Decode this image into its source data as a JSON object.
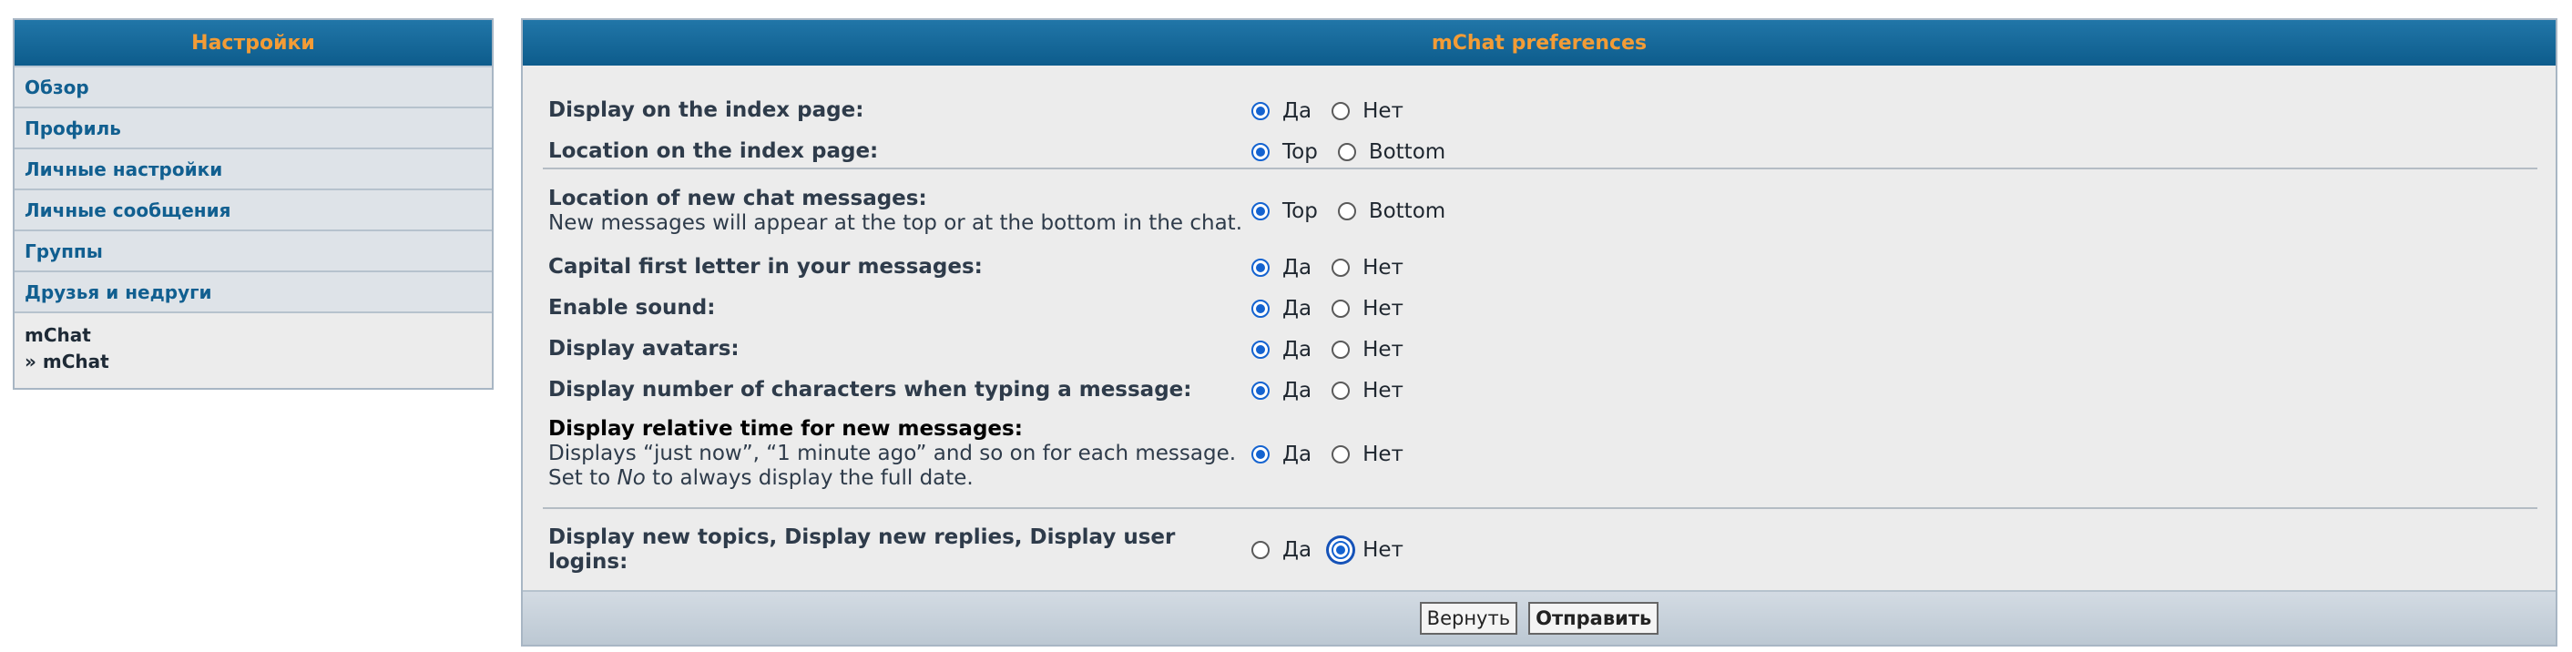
{
  "sidebar": {
    "title": "Настройки",
    "items": [
      {
        "label": "Обзор"
      },
      {
        "label": "Профиль"
      },
      {
        "label": "Личные настройки"
      },
      {
        "label": "Личные сообщения"
      },
      {
        "label": "Группы"
      },
      {
        "label": "Друзья и недруги"
      }
    ],
    "active_section": "mChat",
    "active_item": "» mChat"
  },
  "panel": {
    "title": "mChat preferences",
    "rows": [
      {
        "label": "Display on the index page:",
        "opts": [
          "Да",
          "Нет"
        ],
        "selected": "Да"
      },
      {
        "label": "Location on the index page:",
        "opts": [
          "Top",
          "Bottom"
        ],
        "selected": "Top"
      },
      {
        "label": "Location of new chat messages:",
        "desc": "New messages will appear at the top or at the bottom in the chat.",
        "opts": [
          "Top",
          "Bottom"
        ],
        "selected": "Top"
      },
      {
        "label": "Capital first letter in your messages:",
        "opts": [
          "Да",
          "Нет"
        ],
        "selected": "Да"
      },
      {
        "label": "Enable sound:",
        "opts": [
          "Да",
          "Нет"
        ],
        "selected": "Да"
      },
      {
        "label": "Display avatars:",
        "opts": [
          "Да",
          "Нет"
        ],
        "selected": "Да"
      },
      {
        "label": "Display number of characters when typing a message:",
        "opts": [
          "Да",
          "Нет"
        ],
        "selected": "Да"
      },
      {
        "label": "Display relative time for new messages:",
        "desc1": "Displays “just now”, “1 minute ago” and so on for each message.",
        "desc2_pre": "Set to ",
        "desc2_em": "No",
        "desc2_post": " to always display the full date.",
        "opts": [
          "Да",
          "Нет"
        ],
        "selected": "Да"
      },
      {
        "label": "Display new topics, Display new replies, Display user logins:",
        "opts": [
          "Да",
          "Нет"
        ],
        "selected": "Нет"
      }
    ]
  },
  "footer": {
    "reset_label": "Вернуть",
    "submit_label": "Отправить"
  },
  "colors": {
    "header_bg": "#0d5c8c",
    "header_text": "#f39c36",
    "link": "#115f90",
    "radio_accent": "#1463d0"
  }
}
